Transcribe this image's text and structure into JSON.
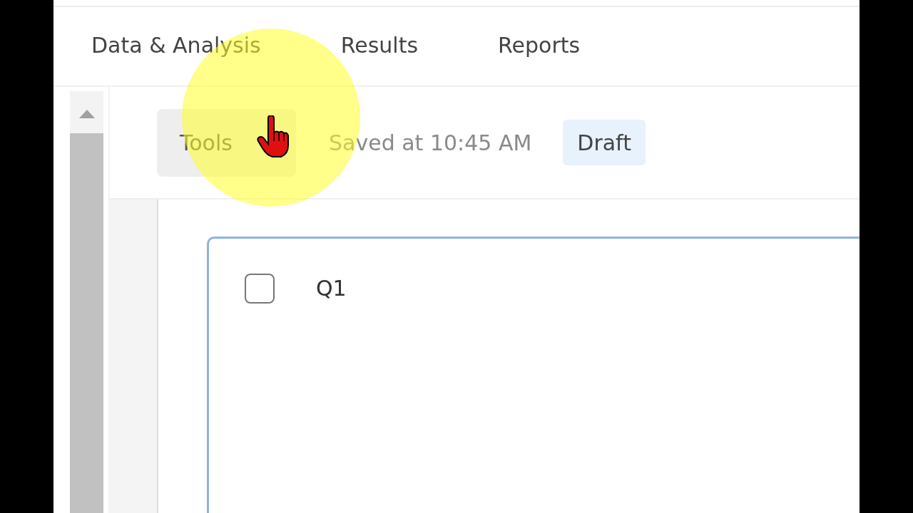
{
  "tabs": [
    {
      "label": "Data & Analysis",
      "selected": false
    },
    {
      "label": "Results",
      "selected": false
    },
    {
      "label": "Reports",
      "selected": false
    }
  ],
  "toolbar": {
    "tools_button": "Tools",
    "save_status": "Saved at 10:45 AM",
    "status_badge": "Draft"
  },
  "question": {
    "label": "Q1",
    "checked": false
  }
}
